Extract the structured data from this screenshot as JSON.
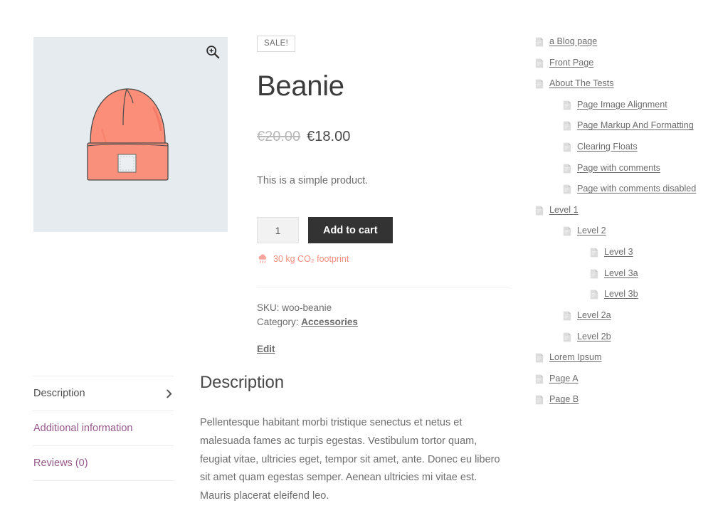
{
  "product": {
    "sale_badge": "SALE!",
    "title": "Beanie",
    "price_old": "€20.00",
    "price_new": "€18.00",
    "short_description": "This is a simple product.",
    "quantity_value": "1",
    "quantity_placeholder": "1",
    "add_to_cart_label": "Add to cart",
    "co2_text": "30 kg CO₂ footprint",
    "sku_label": "SKU:",
    "sku_value": "woo-beanie",
    "category_label": "Category:",
    "category_value": "Accessories",
    "edit_label": "Edit",
    "zoom_icon": "magnifier-plus-icon",
    "image_alt": "beanie-illustration"
  },
  "colors": {
    "accent_purple": "#96588a",
    "co2_pink": "#f58e80",
    "beanie_salmon": "#f98c76",
    "image_bg": "#e6ebef",
    "button_dark": "#333333"
  },
  "tabs": [
    {
      "label": "Description",
      "active": true
    },
    {
      "label": "Additional information",
      "active": false
    },
    {
      "label": "Reviews (0)",
      "active": false
    }
  ],
  "tab_panel": {
    "heading": "Description",
    "body": "Pellentesque habitant morbi tristique senectus et netus et malesuada fames ac turpis egestas. Vestibulum tortor quam, feugiat vitae, ultricies eget, tempor sit amet, ante. Donec eu libero sit amet quam egestas semper. Aenean ultricies mi vitae est. Mauris placerat eleifend leo."
  },
  "sidebar": {
    "items": [
      {
        "label": "a Blog page",
        "level": 0
      },
      {
        "label": "Front Page",
        "level": 0
      },
      {
        "label": "About The Tests",
        "level": 0
      },
      {
        "label": "Page Image Alignment",
        "level": 1
      },
      {
        "label": "Page Markup And Formatting",
        "level": 1
      },
      {
        "label": "Clearing Floats",
        "level": 1
      },
      {
        "label": "Page with comments",
        "level": 1
      },
      {
        "label": "Page with comments disabled",
        "level": 1
      },
      {
        "label": "Level 1",
        "level": 0
      },
      {
        "label": "Level 2",
        "level": 1
      },
      {
        "label": "Level 3",
        "level": 2
      },
      {
        "label": "Level 3a",
        "level": 2
      },
      {
        "label": "Level 3b",
        "level": 2
      },
      {
        "label": "Level 2a",
        "level": 1
      },
      {
        "label": "Level 2b",
        "level": 1
      },
      {
        "label": "Lorem Ipsum",
        "level": 0
      },
      {
        "label": "Page A",
        "level": 0
      },
      {
        "label": "Page B",
        "level": 0
      }
    ]
  }
}
